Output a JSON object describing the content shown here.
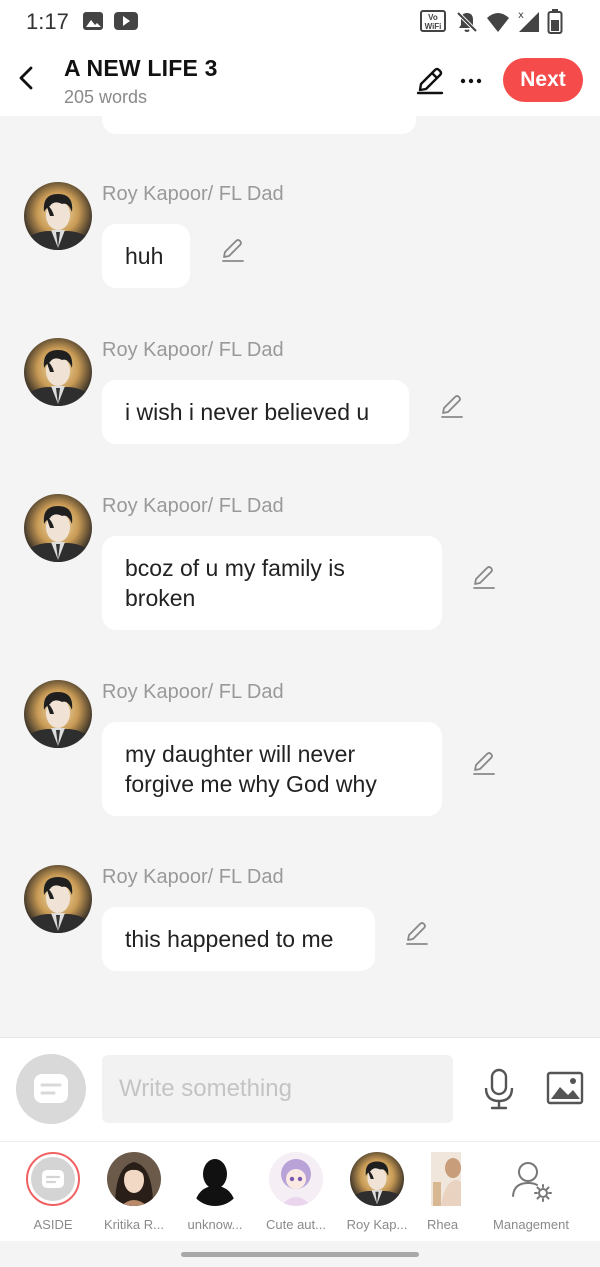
{
  "status_bar": {
    "time": "1:17",
    "wifi_badge": "Vo WiFi"
  },
  "header": {
    "title": "A NEW LIFE 3",
    "subtitle": "205 words",
    "next_label": "Next"
  },
  "messages": [
    {
      "sender": "Roy Kapoor/ FL Dad",
      "text": "huh"
    },
    {
      "sender": "Roy Kapoor/ FL Dad",
      "text": "i wish i never believed u"
    },
    {
      "sender": "Roy Kapoor/ FL Dad",
      "text": "bcoz of u my family is broken"
    },
    {
      "sender": "Roy Kapoor/ FL Dad",
      "text": "my daughter will never forgive me why God why"
    },
    {
      "sender": "Roy Kapoor/ FL Dad",
      "text": "this happened to me"
    }
  ],
  "input": {
    "placeholder": "Write something"
  },
  "characters": [
    {
      "label": "ASIDE"
    },
    {
      "label": "Kritika R..."
    },
    {
      "label": "unknow..."
    },
    {
      "label": "Cute aut..."
    },
    {
      "label": "Roy Kap..."
    },
    {
      "label": "Rhea"
    },
    {
      "label": "Management"
    }
  ],
  "colors": {
    "accent": "#f54b4b",
    "background": "#f4f4f4",
    "bubble": "#ffffff"
  }
}
